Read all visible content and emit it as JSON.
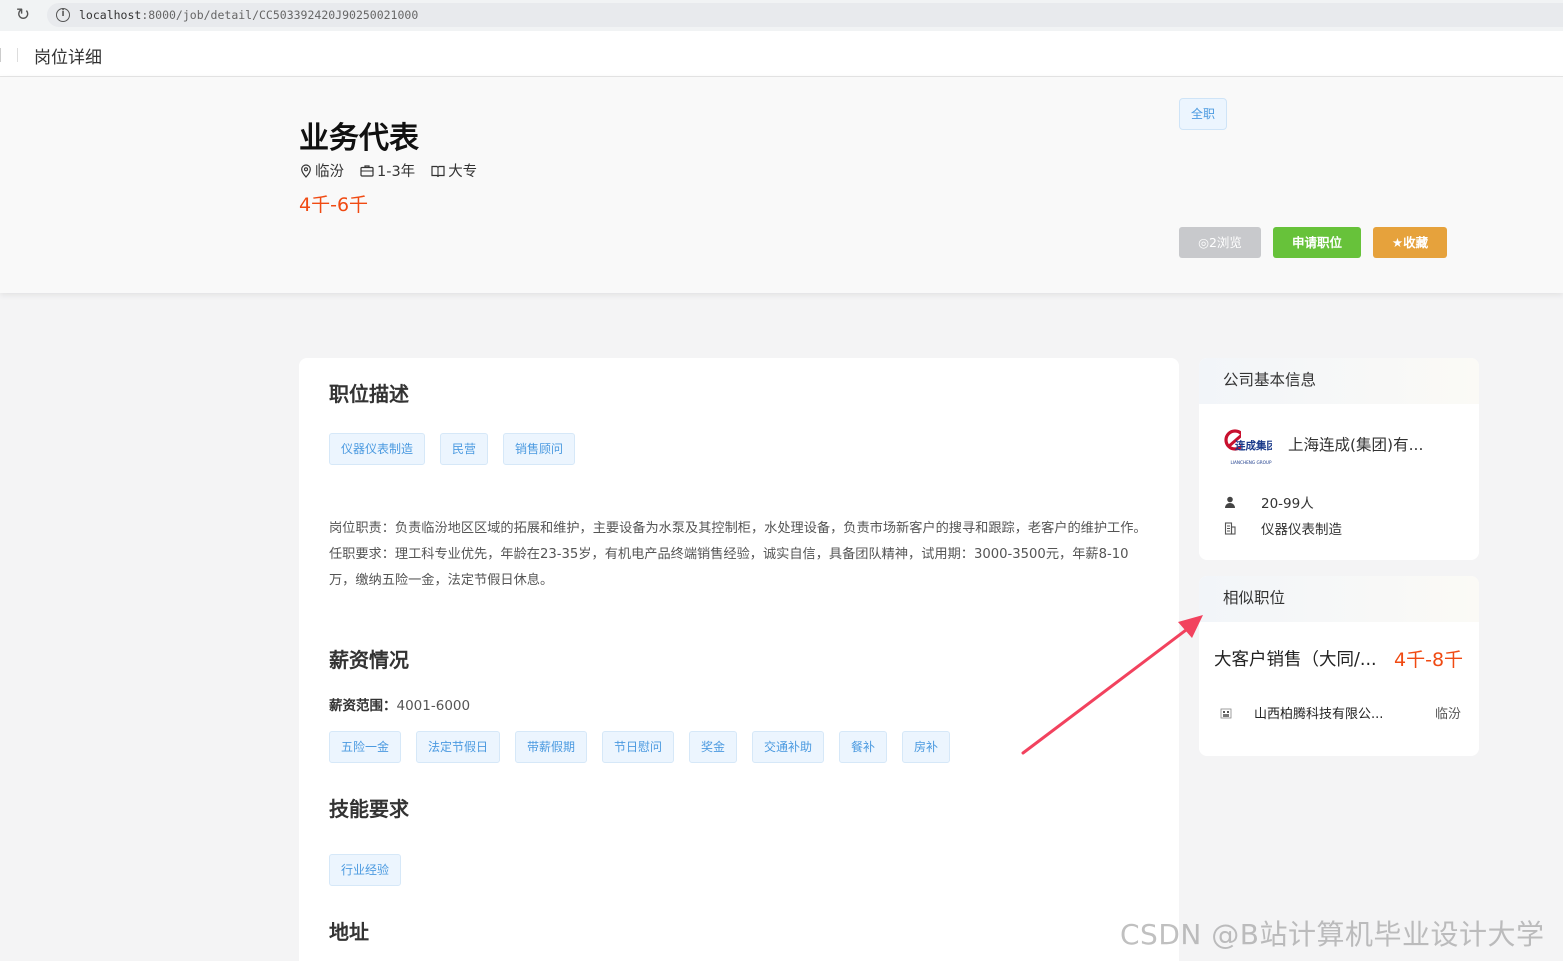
{
  "browser": {
    "url_host": "localhost",
    "url_rest": ":8000/job/detail/CC503392420J90250021000"
  },
  "header": {
    "title": "岗位详细"
  },
  "job": {
    "title": "业务代表",
    "location": "临汾",
    "experience": "1-3年",
    "education": "大专",
    "salary": "4千-6千",
    "type_tag": "全职",
    "views_label": "2浏览",
    "apply_label": "申请职位",
    "favorite_label": "收藏"
  },
  "description": {
    "title": "职位描述",
    "tags": [
      "仪器仪表制造",
      "民营",
      "销售顾问"
    ],
    "text": "岗位职责：负责临汾地区区域的拓展和维护，主要设备为水泵及其控制柜，水处理设备，负责市场新客户的搜寻和跟踪，老客户的维护工作。 任职要求：理工科专业优先，年龄在23-35岁，有机电产品终端销售经验，诚实自信，具备团队精神，试用期：3000-3500元，年薪8-10万，缴纳五险一金，法定节假日休息。"
  },
  "salary_section": {
    "title": "薪资情况",
    "range_label": "薪资范围：",
    "range_value": "4001-6000",
    "benefits": [
      "五险一金",
      "法定节假日",
      "带薪假期",
      "节日慰问",
      "奖金",
      "交通补助",
      "餐补",
      "房补"
    ]
  },
  "skills": {
    "title": "技能要求",
    "tags": [
      "行业经验"
    ]
  },
  "address": {
    "title": "地址"
  },
  "company": {
    "section_title": "公司基本信息",
    "name": "上海连成(集团)有...",
    "logo_text": "连成集团",
    "logo_subtext": "LIANCHENG GROUP",
    "size": "20-99人",
    "industry": "仪器仪表制造"
  },
  "similar": {
    "section_title": "相似职位",
    "items": [
      {
        "title": "大客户销售（大同/...",
        "salary": "4千-8千",
        "company": "山西柏腾科技有限公...",
        "city": "临汾"
      }
    ]
  },
  "watermark": "CSDN @B站计算机毕业设计大学",
  "colors": {
    "salary": "#f04a12",
    "apply": "#67c23a",
    "favorite": "#e6a23c",
    "views": "#c8c9cc",
    "tag_text": "#4b9ae0"
  }
}
